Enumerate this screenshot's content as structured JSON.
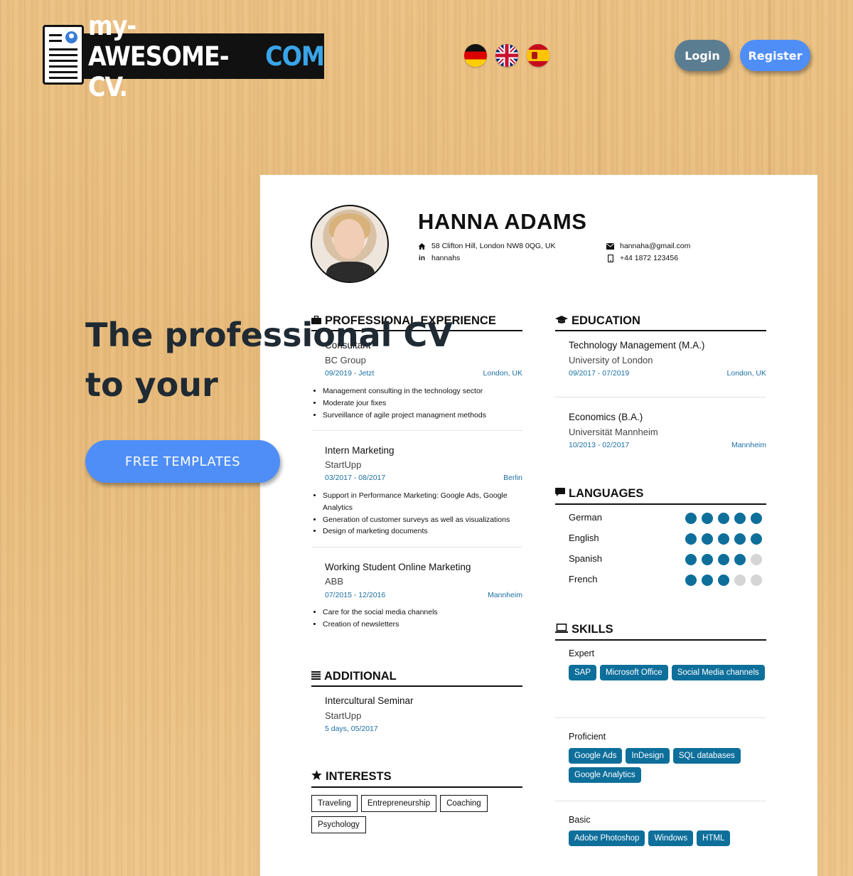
{
  "header": {
    "logo": {
      "text_white": "my-AWESOME-CV.",
      "text_blue": "COM"
    },
    "flags": [
      {
        "name": "german-flag-icon",
        "color": "#dd0000"
      },
      {
        "name": "uk-flag-icon",
        "color": "#012169"
      },
      {
        "name": "spanish-flag-icon",
        "color": "#c60b1e"
      }
    ],
    "login_label": "Login",
    "register_label": "Register"
  },
  "hero": {
    "line1": "The professional CV",
    "line2": "to your",
    "cta_label": "FREE TEMPLATES"
  },
  "cv": {
    "name": "HANNA ADAMS",
    "address": "58 Clifton Hill, London NW8 0QG, UK",
    "linkedin": "hannahs",
    "email": "hannaha@gmail.com",
    "phone": "+44 1872 123456",
    "experience": {
      "title": "PROFESSIONAL EXPERIENCE",
      "items": [
        {
          "role": "Consultant",
          "company": "BC Group",
          "dates": "09/2019 - Jetzt",
          "location": "London, UK",
          "bullets": [
            "Management consulting in the technology sector",
            "Moderate jour fixes",
            "Surveillance of agile project managment methods"
          ]
        },
        {
          "role": "Intern Marketing",
          "company": "StartUpp",
          "dates": "03/2017 - 08/2017",
          "location": "Berlin",
          "bullets": [
            "Support in Performance Marketing: Google Ads, Google Analytics",
            "Generation of customer surveys as well as visualizations",
            "Design of marketing documents"
          ]
        },
        {
          "role": "Working Student Online Marketing",
          "company": "ABB",
          "dates": "07/2015 - 12/2016",
          "location": "Mannheim",
          "bullets": [
            "Care for the social media channels",
            "Creation of newsletters"
          ]
        }
      ]
    },
    "additional": {
      "title": "ADDITIONAL",
      "items": [
        {
          "title": "Intercultural Seminar",
          "org": "StartUpp",
          "meta": "5 days, 05/2017"
        }
      ]
    },
    "interests": {
      "title": "INTERESTS",
      "items": [
        "Traveling",
        "Entrepreneurship",
        "Coaching",
        "Psychology"
      ]
    },
    "education": {
      "title": "EDUCATION",
      "items": [
        {
          "degree": "Technology Management (M.A.)",
          "school": "University of London",
          "dates": "09/2017 - 07/2019",
          "location": "London, UK"
        },
        {
          "degree": "Economics (B.A.)",
          "school": "Universität Mannheim",
          "dates": "10/2013 - 02/2017",
          "location": "Mannheim"
        }
      ]
    },
    "languages": {
      "title": "LANGUAGES",
      "items": [
        {
          "name": "German",
          "level": 5
        },
        {
          "name": "English",
          "level": 5
        },
        {
          "name": "Spanish",
          "level": 4
        },
        {
          "name": "French",
          "level": 3
        }
      ],
      "max_level": 5,
      "dot_color": "#0e6f9b"
    },
    "skills": {
      "title": "SKILLS",
      "groups": [
        {
          "level": "Expert",
          "tags": [
            "SAP",
            "Microsoft Office",
            "Social Media channels"
          ]
        },
        {
          "level": "Proficient",
          "tags": [
            "Google Ads",
            "InDesign",
            "SQL databases",
            "Google Analytics"
          ]
        },
        {
          "level": "Basic",
          "tags": [
            "Adobe Photoshop",
            "Windows",
            "HTML"
          ]
        }
      ]
    }
  },
  "colors": {
    "accent": "#4f8ef7",
    "login": "#5b7d92",
    "cv_accent": "#0e6f9b"
  }
}
